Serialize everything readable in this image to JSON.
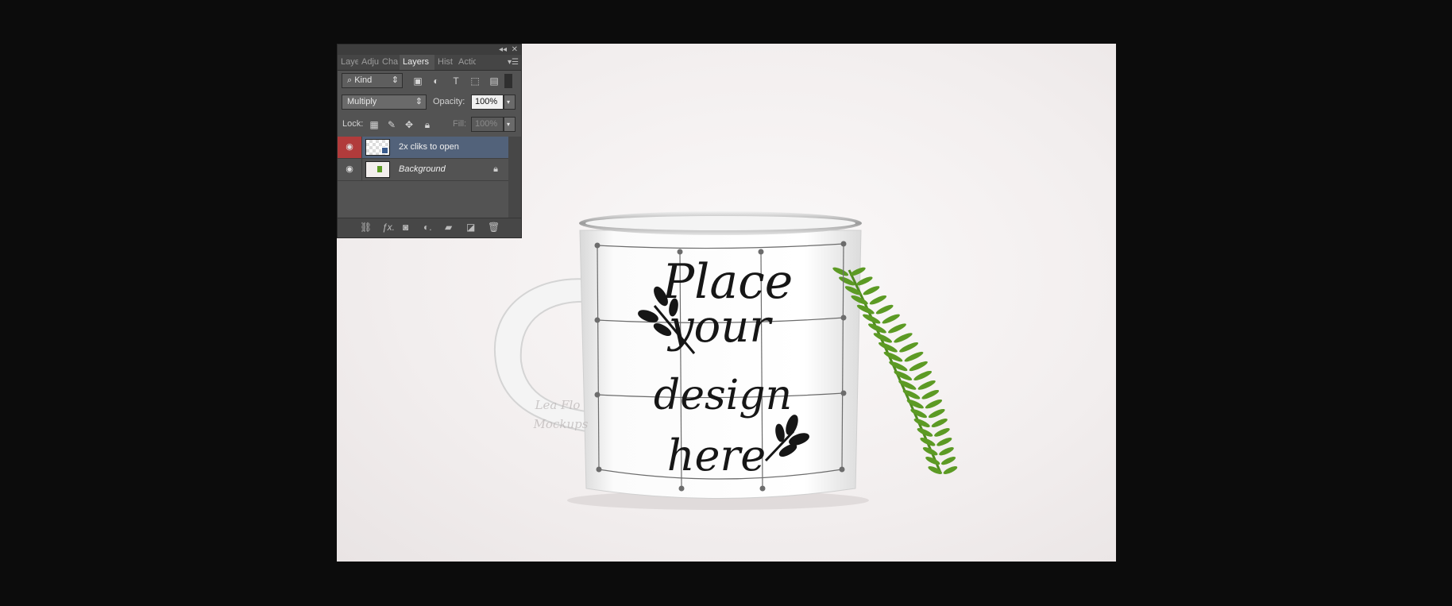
{
  "panel": {
    "tabs": [
      {
        "label": "Laye",
        "active": false
      },
      {
        "label": "Adju",
        "active": false
      },
      {
        "label": "Cha",
        "active": false
      },
      {
        "label": "Layers",
        "active": true
      },
      {
        "label": "Hist",
        "active": false
      },
      {
        "label": "Actic",
        "active": false
      }
    ],
    "filter_label": "Kind",
    "blend_mode": "Multiply",
    "opacity_label": "Opacity:",
    "opacity_value": "100%",
    "lock_label": "Lock:",
    "fill_label": "Fill:",
    "fill_value": "100%",
    "layers": [
      {
        "name": "2x cliks to open",
        "selected": true,
        "visible": true,
        "locked": false,
        "italic": false
      },
      {
        "name": "Background",
        "selected": false,
        "visible": true,
        "locked": true,
        "italic": true
      }
    ]
  },
  "artwork": {
    "lines": [
      "Place",
      "your",
      "design",
      "here"
    ],
    "watermark": [
      "Lea Flo",
      "Mockups"
    ]
  },
  "colors": {
    "selected_layer": "#52627a",
    "eye_selected": "#b13b3b",
    "fern": "#4f8a1f"
  }
}
